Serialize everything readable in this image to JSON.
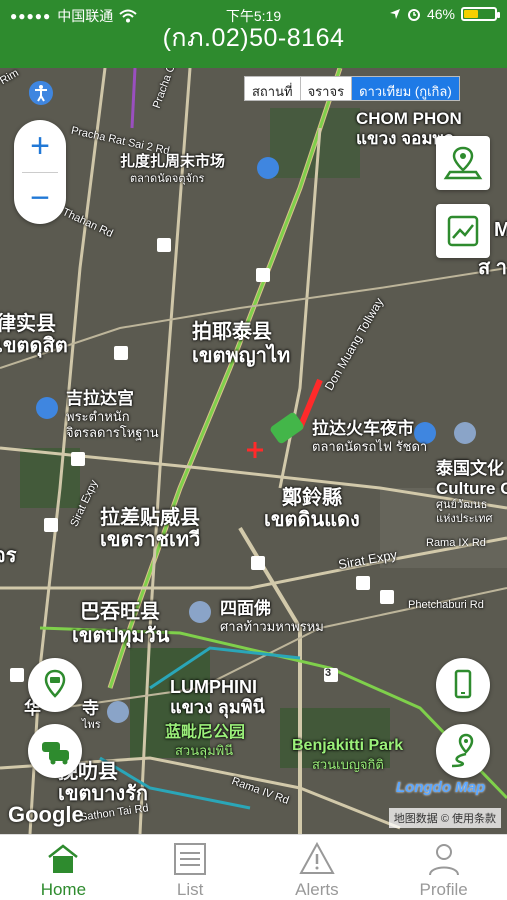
{
  "status_bar": {
    "carrier": "中国联通",
    "time": "下午5:19",
    "battery": "46%",
    "battery_level": 0.46
  },
  "header": {
    "title": "(กภ.02)50-8164"
  },
  "map": {
    "type_tabs": [
      {
        "label": "สถานที่",
        "active": false
      },
      {
        "label": "จราจร",
        "active": false
      },
      {
        "label": "ดาวเทียม (กูเกิล)",
        "active": true
      }
    ],
    "zoom_in": "+",
    "zoom_out": "−",
    "labels": {
      "chom_phon_en": "CHOM PHON",
      "chom_phon_th": "แขวง จอมพล",
      "market_cn": "扎度扎周末市场",
      "market_th": "ตลาดนัดจตุจักร",
      "phaya_thai_cn": "拍耶泰县",
      "phaya_thai_th": "เขตพญาไท",
      "chitralada_cn": "吉拉达宫",
      "chitralada_th1": "พระตำหนัก",
      "chitralada_th2": "จิตรลดารโหฐาน",
      "dusit_cn": "律实县",
      "dusit_th": "เขตดุสิต",
      "ratchada_cn": "拉达火车夜市",
      "ratchada_th": "ตลาดนัดรถไฟ รัชดา",
      "din_daeng_cn": "鄭鈴縣",
      "din_daeng_th": "เขตดินแดง",
      "ratchathewi_cn": "拉差贴威县",
      "ratchathewi_th": "เขตราชเทวี",
      "pathum_wan_cn": "巴吞旺县",
      "pathum_wan_th": "เขตปทุมวัน",
      "erawan_cn": "四面佛",
      "erawan_th": "ศาลท้าวมหาพรหม",
      "lumphini_en": "LUMPHINI",
      "lumphini_th": "แขวง ลุมพินี",
      "lumphini_park_cn": "蓝毗尼公园",
      "lumphini_park_th": "สวนลุมพินี",
      "benjakitti_en": "Benjakitti Park",
      "benjakitti_th": "สวนเบญจกิติ",
      "bang_rak_cn": "挽叻县",
      "bang_rak_th": "เขตบางรัก",
      "culture_cn": "泰国文化",
      "culture_en": "Culture C",
      "culture_th1": "ศูนย์วัฒนธ",
      "culture_th2": "แห่งประเทศ",
      "huai_khwang_th": "ส า",
      "huai_khwang_cut": "M",
      "temple_cn": "华",
      "temple_th": "ไพร",
      "temple_cn2": "寺",
      "road_pracha_rat": "Pracha Rat Sai 2 Rd",
      "road_thahan": "Thahan Rd",
      "road_sirat_1": "Sirat Expy",
      "road_sirat_2": "Sirat Expy",
      "road_rama9": "Rama IX Rd",
      "road_phetchaburi": "Phetchaburi Rd",
      "road_rama4": "Rama IV Rd",
      "road_silom": "Sathon Tai Rd",
      "road_muang_toll": "Don Muang Tollway",
      "road_pracha_ch": "Pracha Ch",
      "road_rim": "Rim",
      "left_edge_j": "จร",
      "route_num": "3"
    },
    "copyright": "地图数据 ©  使用条款",
    "google_logo": "Google",
    "longdo_logo": "Longdo Map"
  },
  "tabs": [
    {
      "label": "Home",
      "icon": "home-icon",
      "active": true
    },
    {
      "label": "List",
      "icon": "list-icon",
      "active": false
    },
    {
      "label": "Alerts",
      "icon": "alert-icon",
      "active": false
    },
    {
      "label": "Profile",
      "icon": "profile-icon",
      "active": false
    }
  ],
  "colors": {
    "brand_green": "#2e8b2e",
    "map_active_tab": "#1e7ae6",
    "inactive_tab": "#999999"
  }
}
